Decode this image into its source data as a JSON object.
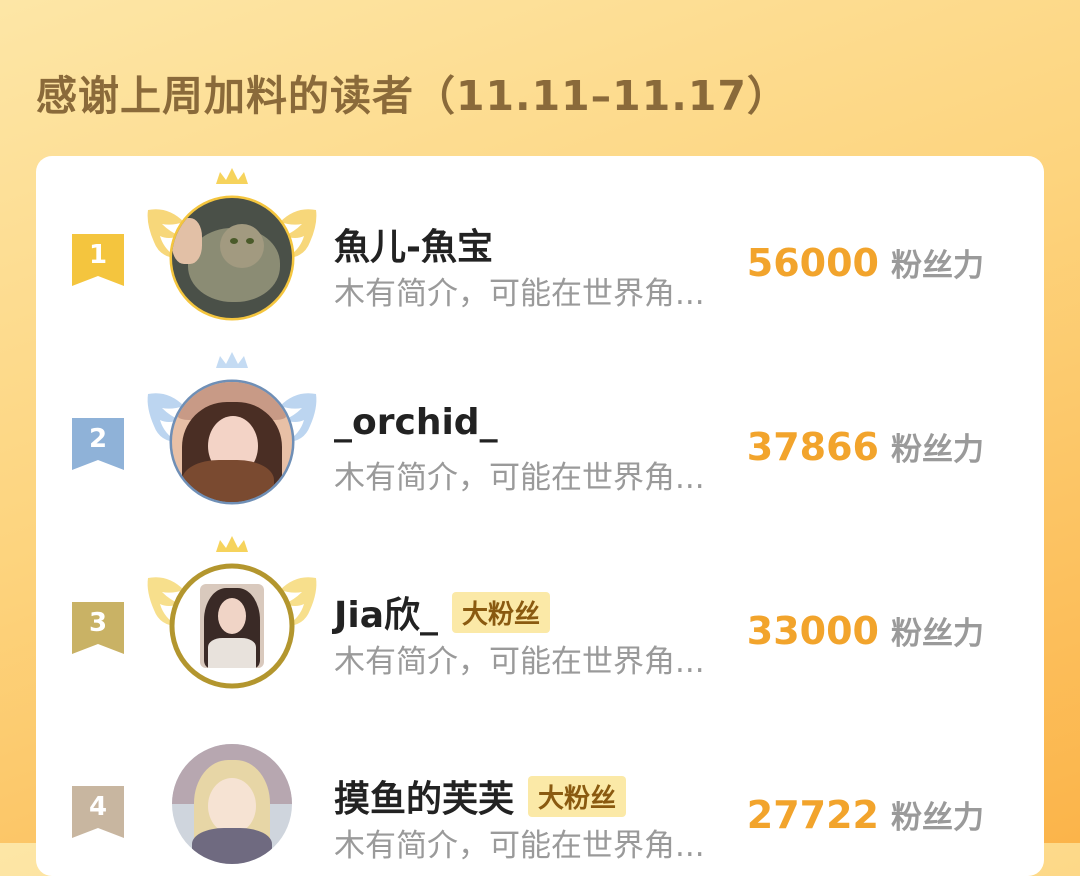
{
  "title": "感谢上周加料的读者（11.11–11.17）",
  "colors": {
    "accent": "#f2a42c",
    "rank1": "#f4c53e",
    "rank2": "#8fb2d8",
    "rank3": "#c9b265",
    "rank4": "#c8b6a0"
  },
  "readers": [
    {
      "rank": "1",
      "name": "魚儿-魚宝",
      "badge": "",
      "bio": "木有简介，可能在世界角...",
      "score": "56000",
      "unit": "粉丝力"
    },
    {
      "rank": "2",
      "name": "_orchid_",
      "badge": "",
      "bio": "木有简介，可能在世界角...",
      "score": "37866",
      "unit": "粉丝力"
    },
    {
      "rank": "3",
      "name": "Jia欣_",
      "badge": "大粉丝",
      "bio": "木有简介，可能在世界角...",
      "score": "33000",
      "unit": "粉丝力"
    },
    {
      "rank": "4",
      "name": "摸鱼的芙芙",
      "badge": "大粉丝",
      "bio": "木有简介，可能在世界角...",
      "score": "27722",
      "unit": "粉丝力"
    }
  ]
}
